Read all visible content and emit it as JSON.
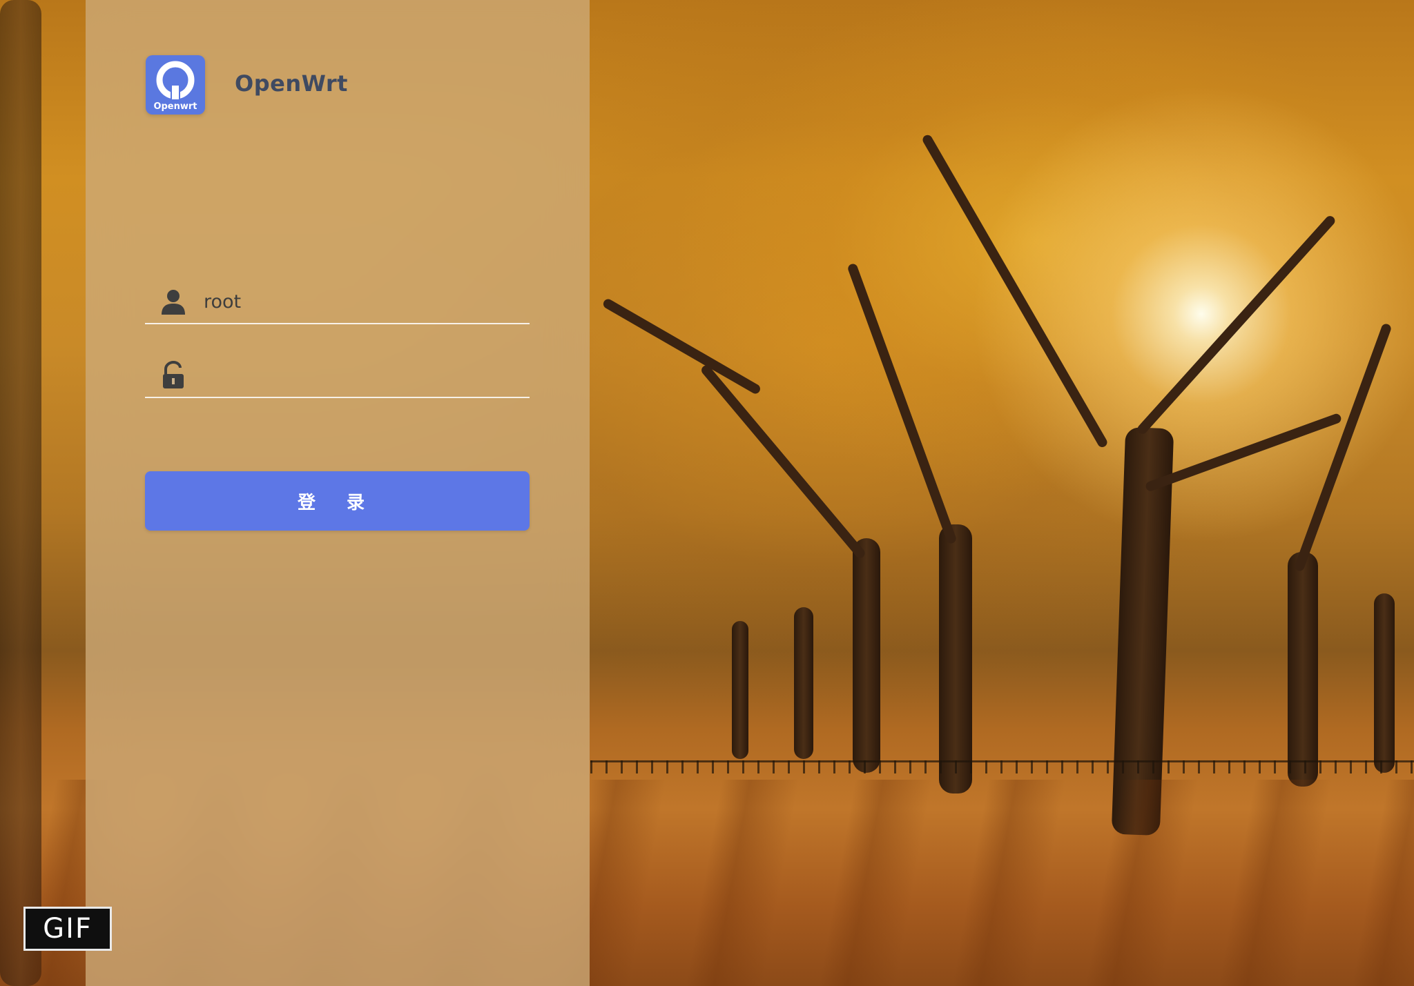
{
  "logo": {
    "icon": "openwrt-logo-icon",
    "small_text": "Openwrt"
  },
  "brand": {
    "name": "OpenWrt"
  },
  "login": {
    "username_icon": "user-icon",
    "username_value": "root",
    "password_icon": "unlock-icon",
    "password_value": "",
    "submit_label": "登 录"
  },
  "badge": {
    "label": "GIF"
  },
  "colors": {
    "accent": "#5d77e6",
    "logo_bg": "#5a78e0",
    "brand_text": "#3f4a61"
  }
}
